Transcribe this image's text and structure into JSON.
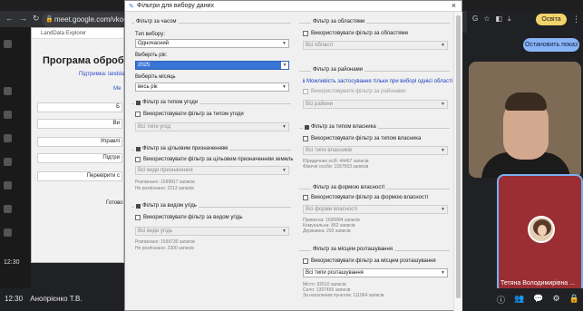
{
  "browser": {
    "url": "meet.google.com/vko-jtcl",
    "profile_label": "Освіта"
  },
  "meet": {
    "stop_presenting": "Остановить показ",
    "participant_name": "Тетяна Володимирівна ...",
    "bottom_time": "12:30",
    "bottom_presenter": "Анопрієнко Т.В."
  },
  "app": {
    "window_title": "LandData Explorer",
    "heading": "Програма обробки да",
    "link1": "Підтримка: landdata",
    "link2": "Ме",
    "btn1": "Б",
    "btn2": "Ви",
    "btn3": "Управлі",
    "btn4": "Підтри",
    "btn5": "Перевірити с",
    "label_gotovo": "Готово",
    "inner_time": "12:30",
    "inner_presenter": "Анопрієнко Т.В."
  },
  "dialog": {
    "title": "Фільтри для вибору даних",
    "time_group": {
      "title": "Фільтр за часом",
      "choice_type_label": "Тип вибору:",
      "choice_type_value": "Одночасний",
      "year_label": "Виберіть рік:",
      "year_value": "2025",
      "month_label": "Виберіть місяць",
      "month_value": "весь рік"
    },
    "deal_type_group": {
      "title": "Фільтр за типом угоди",
      "checkbox": "Використовувати фільтр за типом угоди",
      "combo": "Всі типи угод"
    },
    "purpose_group": {
      "title": "Фільтр за цільовим призначенням",
      "checkbox": "Використовувати фільтр за цільовим призначенням земель",
      "combo": "Всі види призначення",
      "stat1": "Розпізнано: 1599817 записів",
      "stat2": "Не розпізнано: 2213 записів"
    },
    "land_type_group": {
      "title": "Фільтр за видом угідь",
      "checkbox": "Використовувати фільтр за видом угідь",
      "combo": "Всі види угідь",
      "stat1": "Розпізнано: 1599730 записів",
      "stat2": "Не розпізнано: 2300 записів"
    },
    "region_group": {
      "title": "Фільтр за областями",
      "checkbox": "Використовувати фільтр за областями",
      "combo": "Всі області"
    },
    "district_group": {
      "title": "Фільтр за районами",
      "info": "Можливість застосування тільки при виборі однієї області",
      "checkbox": "Використовувати фільтр за районами",
      "combo": "Всі райони"
    },
    "owner_type_group": {
      "title": "Фільтр за типом власника",
      "checkbox": "Використовувати фільтр за типом власника",
      "combo": "Всі типи власників",
      "stat1": "Юридичних осіб: 44467 записів",
      "stat2": "Фізичні особи: 1557563 записів"
    },
    "ownership_group": {
      "title": "Фільтр за формою власності",
      "checkbox": "Використовувати фільтр за формою власності",
      "combo": "Всі форми власності",
      "stat1": "Приватна: 1600884 записів",
      "stat2": "Комунальна: 852 записів",
      "stat3": "Державна: 292 записів"
    },
    "location_group": {
      "title": "Фільтр за місцем розташування",
      "checkbox": "Використовувати фільтр за місцем розташування",
      "combo": "Всі типи розташування",
      "stat1": "Місто: 92610 записів",
      "stat2": "Село: 1397456 записів",
      "stat3": "За населеним пунктом: 111064 записів"
    }
  },
  "colors": {
    "accent": "#3875d7",
    "stop_button": "#8ab4f8",
    "participant_tile": "#9a2e33",
    "profile_badge": "#f3d36b"
  }
}
